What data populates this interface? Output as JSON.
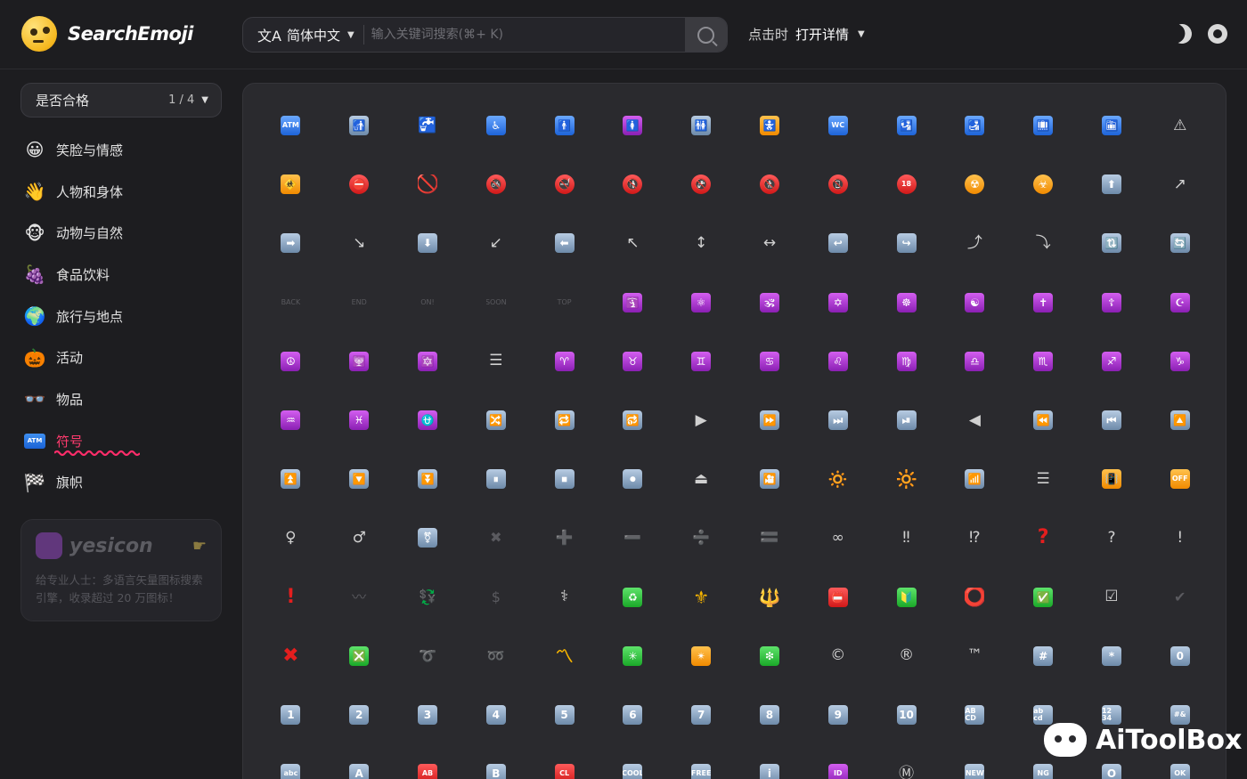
{
  "header": {
    "brand": "SearchEmoji",
    "language_label": "简体中文",
    "language_icon": "文A",
    "search_placeholder": "输入关键词搜索(⌘+ K)",
    "click_label": "点击时",
    "click_value": "打开详情"
  },
  "filter": {
    "label": "是否合格",
    "page": "1 / 4"
  },
  "categories": [
    {
      "label": "笑脸与情感",
      "icon": "😀"
    },
    {
      "label": "人物和身体",
      "icon": "👋"
    },
    {
      "label": "动物与自然",
      "icon": "🐵"
    },
    {
      "label": "食品饮料",
      "icon": "🍇"
    },
    {
      "label": "旅行与地点",
      "icon": "🌍"
    },
    {
      "label": "活动",
      "icon": "🎃"
    },
    {
      "label": "物品",
      "icon": "👓"
    },
    {
      "label": "符号",
      "icon": "ATM",
      "active": true
    },
    {
      "label": "旗帜",
      "icon": "🏁"
    }
  ],
  "ad": {
    "name": "yesicon",
    "text": "给专业人士：多语言矢量图标搜索引擎，收录超过 20 万图标！"
  },
  "watermark": "AiToolBox",
  "emoji_grid": [
    {
      "k": "blue",
      "t": "ATM",
      "s": 1
    },
    {
      "k": "gray",
      "t": "🚮"
    },
    {
      "k": "plain",
      "t": "🚰"
    },
    {
      "k": "blue",
      "t": "♿"
    },
    {
      "k": "blue",
      "t": "🚹"
    },
    {
      "k": "purple",
      "t": "🚺"
    },
    {
      "k": "gray",
      "t": "🚻"
    },
    {
      "k": "orange",
      "t": "🚼"
    },
    {
      "k": "blue",
      "t": "WC",
      "s": 1
    },
    {
      "k": "blue",
      "t": "🛂"
    },
    {
      "k": "blue",
      "t": "🛃"
    },
    {
      "k": "blue",
      "t": "🛄"
    },
    {
      "k": "blue",
      "t": "🛅"
    },
    {
      "k": "plain",
      "t": "⚠"
    },
    {
      "k": "orange",
      "t": "🚸"
    },
    {
      "k": "red",
      "t": "⛔",
      "c": 1
    },
    {
      "k": "redtxt",
      "t": "🚫"
    },
    {
      "k": "red",
      "t": "🚳",
      "c": 1
    },
    {
      "k": "red",
      "t": "🚭",
      "c": 1
    },
    {
      "k": "red",
      "t": "🚯",
      "c": 1
    },
    {
      "k": "red",
      "t": "🚱",
      "c": 1
    },
    {
      "k": "red",
      "t": "🚷",
      "c": 1
    },
    {
      "k": "red",
      "t": "📵",
      "c": 1
    },
    {
      "k": "red",
      "t": "18",
      "c": 1,
      "s": 1
    },
    {
      "k": "orange",
      "t": "☢",
      "c": 1
    },
    {
      "k": "orange",
      "t": "☣",
      "c": 1
    },
    {
      "k": "gray",
      "t": "⬆"
    },
    {
      "k": "plain",
      "t": "↗"
    },
    {
      "k": "gray",
      "t": "➡"
    },
    {
      "k": "plain",
      "t": "↘"
    },
    {
      "k": "gray",
      "t": "⬇"
    },
    {
      "k": "plain",
      "t": "↙"
    },
    {
      "k": "gray",
      "t": "⬅"
    },
    {
      "k": "plain",
      "t": "↖"
    },
    {
      "k": "plain",
      "t": "↕"
    },
    {
      "k": "plain",
      "t": "↔"
    },
    {
      "k": "gray",
      "t": "↩"
    },
    {
      "k": "gray",
      "t": "↪"
    },
    {
      "k": "plain",
      "t": "⤴"
    },
    {
      "k": "plain",
      "t": "⤵"
    },
    {
      "k": "gray",
      "t": "🔃"
    },
    {
      "k": "gray",
      "t": "🔄"
    },
    {
      "k": "dim",
      "t": "BACK",
      "s": 1
    },
    {
      "k": "dim",
      "t": "END",
      "s": 1
    },
    {
      "k": "dim",
      "t": "ON!",
      "s": 1
    },
    {
      "k": "dim",
      "t": "SOON",
      "s": 1
    },
    {
      "k": "dim",
      "t": "TOP",
      "s": 1
    },
    {
      "k": "purple",
      "t": "🛐"
    },
    {
      "k": "purple",
      "t": "⚛"
    },
    {
      "k": "purple",
      "t": "🕉"
    },
    {
      "k": "purple",
      "t": "✡"
    },
    {
      "k": "purple",
      "t": "☸"
    },
    {
      "k": "purple",
      "t": "☯"
    },
    {
      "k": "purple",
      "t": "✝"
    },
    {
      "k": "purple",
      "t": "☦"
    },
    {
      "k": "purple",
      "t": "☪"
    },
    {
      "k": "purple",
      "t": "☮"
    },
    {
      "k": "purple",
      "t": "🕎"
    },
    {
      "k": "purple",
      "t": "🔯"
    },
    {
      "k": "plain",
      "t": "☰"
    },
    {
      "k": "purple",
      "t": "♈"
    },
    {
      "k": "purple",
      "t": "♉"
    },
    {
      "k": "purple",
      "t": "♊"
    },
    {
      "k": "purple",
      "t": "♋"
    },
    {
      "k": "purple",
      "t": "♌"
    },
    {
      "k": "purple",
      "t": "♍"
    },
    {
      "k": "purple",
      "t": "♎"
    },
    {
      "k": "purple",
      "t": "♏"
    },
    {
      "k": "purple",
      "t": "♐"
    },
    {
      "k": "purple",
      "t": "♑"
    },
    {
      "k": "purple",
      "t": "♒"
    },
    {
      "k": "purple",
      "t": "♓"
    },
    {
      "k": "purple",
      "t": "⛎"
    },
    {
      "k": "gray",
      "t": "🔀"
    },
    {
      "k": "gray",
      "t": "🔁"
    },
    {
      "k": "gray",
      "t": "🔂"
    },
    {
      "k": "plain",
      "t": "▶"
    },
    {
      "k": "gray",
      "t": "⏩"
    },
    {
      "k": "gray",
      "t": "⏭"
    },
    {
      "k": "gray",
      "t": "⏯"
    },
    {
      "k": "plain",
      "t": "◀"
    },
    {
      "k": "gray",
      "t": "⏪"
    },
    {
      "k": "gray",
      "t": "⏮"
    },
    {
      "k": "gray",
      "t": "🔼"
    },
    {
      "k": "gray",
      "t": "⏫"
    },
    {
      "k": "gray",
      "t": "🔽"
    },
    {
      "k": "gray",
      "t": "⏬"
    },
    {
      "k": "gray",
      "t": "⏸"
    },
    {
      "k": "gray",
      "t": "⏹"
    },
    {
      "k": "gray",
      "t": "⏺"
    },
    {
      "k": "plain",
      "t": "⏏"
    },
    {
      "k": "gray",
      "t": "🎦"
    },
    {
      "k": "yellow",
      "t": "🔅"
    },
    {
      "k": "yellow",
      "t": "🔆"
    },
    {
      "k": "gray",
      "t": "📶"
    },
    {
      "k": "plain",
      "t": "☰"
    },
    {
      "k": "orange",
      "t": "📳"
    },
    {
      "k": "orange",
      "t": "OFF",
      "s": 1
    },
    {
      "k": "plain",
      "t": "♀"
    },
    {
      "k": "plain",
      "t": "♂"
    },
    {
      "k": "gray",
      "t": "⚧"
    },
    {
      "k": "dim",
      "t": "✖"
    },
    {
      "k": "dim",
      "t": "➕"
    },
    {
      "k": "dim",
      "t": "➖"
    },
    {
      "k": "dim",
      "t": "➗"
    },
    {
      "k": "plain",
      "t": "🟰"
    },
    {
      "k": "plain",
      "t": "∞"
    },
    {
      "k": "plain",
      "t": "‼"
    },
    {
      "k": "plain",
      "t": "⁉"
    },
    {
      "k": "redtxt",
      "t": "?"
    },
    {
      "k": "plain",
      "t": "?"
    },
    {
      "k": "plain",
      "t": "!"
    },
    {
      "k": "redtxt",
      "t": "!"
    },
    {
      "k": "dim",
      "t": "〰"
    },
    {
      "k": "dim",
      "t": "💱"
    },
    {
      "k": "dim",
      "t": "$"
    },
    {
      "k": "plain",
      "t": "⚕"
    },
    {
      "k": "green",
      "t": "♻"
    },
    {
      "k": "yellow",
      "t": "⚜"
    },
    {
      "k": "yellow",
      "t": "🔱"
    },
    {
      "k": "red",
      "t": "📛"
    },
    {
      "k": "green",
      "t": "🔰"
    },
    {
      "k": "redtxt",
      "t": "⭕"
    },
    {
      "k": "green",
      "t": "✅"
    },
    {
      "k": "plain",
      "t": "☑"
    },
    {
      "k": "dim",
      "t": "✔"
    },
    {
      "k": "redtxt",
      "t": "✖"
    },
    {
      "k": "green",
      "t": "❎"
    },
    {
      "k": "dim",
      "t": "➰"
    },
    {
      "k": "dim",
      "t": "➿"
    },
    {
      "k": "yellow",
      "t": "〽"
    },
    {
      "k": "green",
      "t": "✳"
    },
    {
      "k": "orange",
      "t": "✴"
    },
    {
      "k": "green",
      "t": "❇"
    },
    {
      "k": "plain",
      "t": "©"
    },
    {
      "k": "plain",
      "t": "®"
    },
    {
      "k": "plain",
      "t": "™"
    },
    {
      "k": "gray",
      "t": "#"
    },
    {
      "k": "gray",
      "t": "*"
    },
    {
      "k": "gray",
      "t": "0"
    },
    {
      "k": "gray",
      "t": "1"
    },
    {
      "k": "gray",
      "t": "2"
    },
    {
      "k": "gray",
      "t": "3"
    },
    {
      "k": "gray",
      "t": "4"
    },
    {
      "k": "gray",
      "t": "5"
    },
    {
      "k": "gray",
      "t": "6"
    },
    {
      "k": "gray",
      "t": "7"
    },
    {
      "k": "gray",
      "t": "8"
    },
    {
      "k": "gray",
      "t": "9"
    },
    {
      "k": "gray",
      "t": "10"
    },
    {
      "k": "gray",
      "t": "AB CD",
      "s": 1
    },
    {
      "k": "gray",
      "t": "ab cd",
      "s": 1
    },
    {
      "k": "gray",
      "t": "12 34",
      "s": 1
    },
    {
      "k": "gray",
      "t": "#&",
      "s": 1
    },
    {
      "k": "gray",
      "t": "abc",
      "s": 1
    },
    {
      "k": "gray",
      "t": "A"
    },
    {
      "k": "red",
      "t": "AB",
      "s": 1
    },
    {
      "k": "gray",
      "t": "B"
    },
    {
      "k": "red",
      "t": "CL",
      "s": 1
    },
    {
      "k": "gray",
      "t": "COOL",
      "s": 1
    },
    {
      "k": "gray",
      "t": "FREE",
      "s": 1
    },
    {
      "k": "gray",
      "t": "i"
    },
    {
      "k": "purple",
      "t": "ID",
      "s": 1
    },
    {
      "k": "plain",
      "t": "Ⓜ"
    },
    {
      "k": "gray",
      "t": "NEW",
      "s": 1
    },
    {
      "k": "gray",
      "t": "NG",
      "s": 1
    },
    {
      "k": "gray",
      "t": "O"
    },
    {
      "k": "gray",
      "t": "OK",
      "s": 1
    }
  ]
}
